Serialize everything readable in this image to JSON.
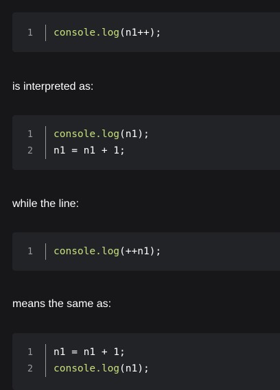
{
  "blocks": [
    {
      "lines": [
        {
          "num": "1",
          "fn": "console.log",
          "rest": "(n1++);"
        }
      ]
    },
    {
      "lines": [
        {
          "num": "1",
          "fn": "console.log",
          "rest": "(n1);"
        },
        {
          "num": "2",
          "fn": "",
          "rest": "n1 = n1 + 1;"
        }
      ]
    },
    {
      "lines": [
        {
          "num": "1",
          "fn": "console.log",
          "rest": "(++n1);"
        }
      ]
    },
    {
      "lines": [
        {
          "num": "1",
          "fn": "",
          "rest": "n1 = n1 + 1;"
        },
        {
          "num": "2",
          "fn": "console.log",
          "rest": "(n1);"
        }
      ]
    }
  ],
  "prose": {
    "p1": "is interpreted as:",
    "p2": "while the line:",
    "p3": "means the same as:"
  },
  "colors": {
    "background": "#17171a",
    "code_background": "#222326",
    "function_color": "#c7e07c",
    "line_number_color": "#9a9a9a"
  }
}
